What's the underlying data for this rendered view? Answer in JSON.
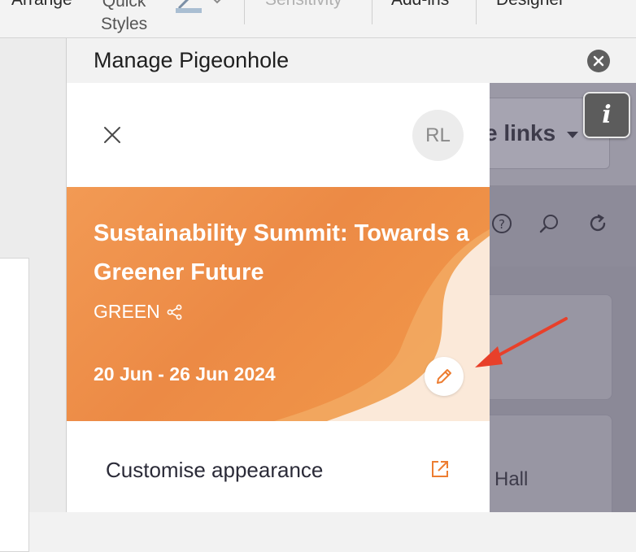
{
  "ribbon": {
    "items": [
      "Arrange",
      "Quick",
      "Styles",
      "Sensitivity",
      "Add-ins",
      "Designer"
    ]
  },
  "pane": {
    "title": "Manage Pigeonhole"
  },
  "background_app": {
    "links_label": "e links",
    "hall_label": "Hall",
    "info_label": "i"
  },
  "modal": {
    "avatar_initials": "RL",
    "event": {
      "title": "Sustainability Summit: Towards a Greener Future",
      "tag": "GREEN",
      "dates": "20 Jun - 26 Jun 2024"
    },
    "customise_label": "Customise appearance"
  },
  "colors": {
    "banner": "#ec8a45",
    "accent": "#ed7d31",
    "arrow": "#e8402a"
  }
}
